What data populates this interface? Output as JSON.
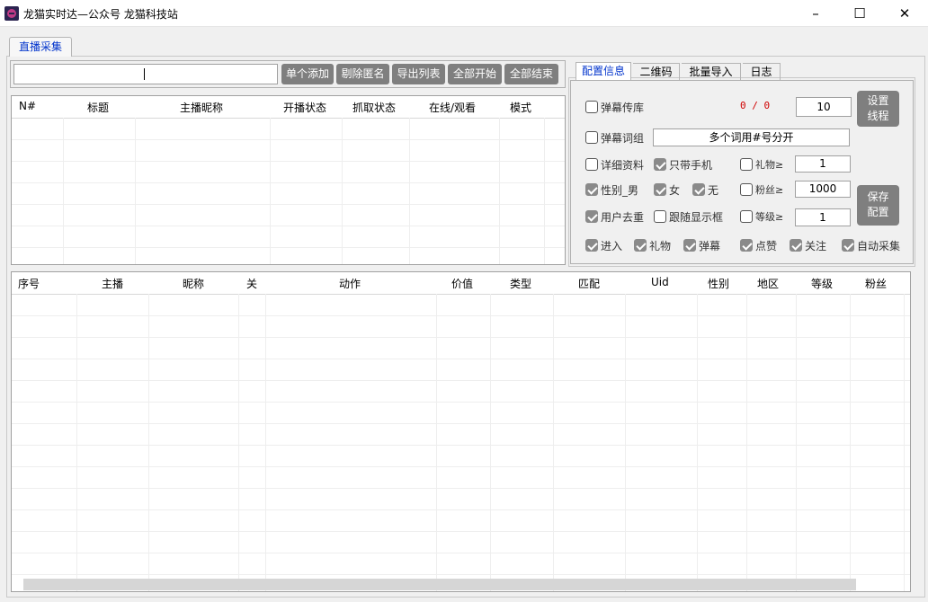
{
  "window": {
    "title": "龙猫实时达—公众号 龙猫科技站",
    "controls": {
      "minimize": "–",
      "maximize": "☐",
      "close": "✕"
    }
  },
  "main_tabs": [
    {
      "label": "直播采集",
      "active": true
    }
  ],
  "toolbar": {
    "search_value": "",
    "buttons": [
      "单个添加",
      "剔除匿名",
      "导出列表",
      "全部开始",
      "全部结束"
    ]
  },
  "room_table": {
    "columns": [
      "N#",
      "标题",
      "主播昵称",
      "开播状态",
      "抓取状态",
      "在线/观看",
      "模式"
    ],
    "rows": []
  },
  "config_tabs": [
    "配置信息",
    "二维码",
    "批量导入",
    "日志"
  ],
  "config": {
    "danmu_store": "弹幕传库",
    "counter": "0 / 0",
    "threads_value": "10",
    "set_threads_button": "设置\n线程",
    "danmu_words": "弹幕词组",
    "words_hint": "多个词用#号分开",
    "detail_info": "详细资料",
    "phone_only": "只带手机",
    "gift_ge": "礼物≥",
    "gift_value": "1",
    "gender_male": "性别_男",
    "female": "女",
    "none": "无",
    "fans_ge": "粉丝≥",
    "fans_value": "1000",
    "save_button": "保存\n配置",
    "dedupe_user": "用户去重",
    "follow_display": "跟随显示框",
    "level_ge": "等级≥",
    "level_value": "1",
    "enter": "进入",
    "gift": "礼物",
    "danmu": "弹幕",
    "like": "点赞",
    "follow": "关注",
    "auto_collect": "自动采集"
  },
  "checks": {
    "danmu_store": false,
    "danmu_words": false,
    "detail_info": false,
    "phone_only": true,
    "gift_ge": false,
    "gender_male": true,
    "female": true,
    "none": true,
    "fans_ge": false,
    "dedupe_user": true,
    "follow_display": false,
    "level_ge": false,
    "enter": true,
    "gift": true,
    "danmu": true,
    "like": true,
    "follow": true,
    "auto_collect": true
  },
  "colors": {
    "button_gray": "#7f7f7f",
    "counter_red": "#d00000",
    "active_tab_blue": "#0033cc"
  },
  "event_table": {
    "columns": [
      "序号",
      "主播",
      "昵称",
      "关",
      "动作",
      "价值",
      "类型",
      "匹配",
      "Uid",
      "性别",
      "地区",
      "等级",
      "粉丝"
    ],
    "rows": []
  }
}
